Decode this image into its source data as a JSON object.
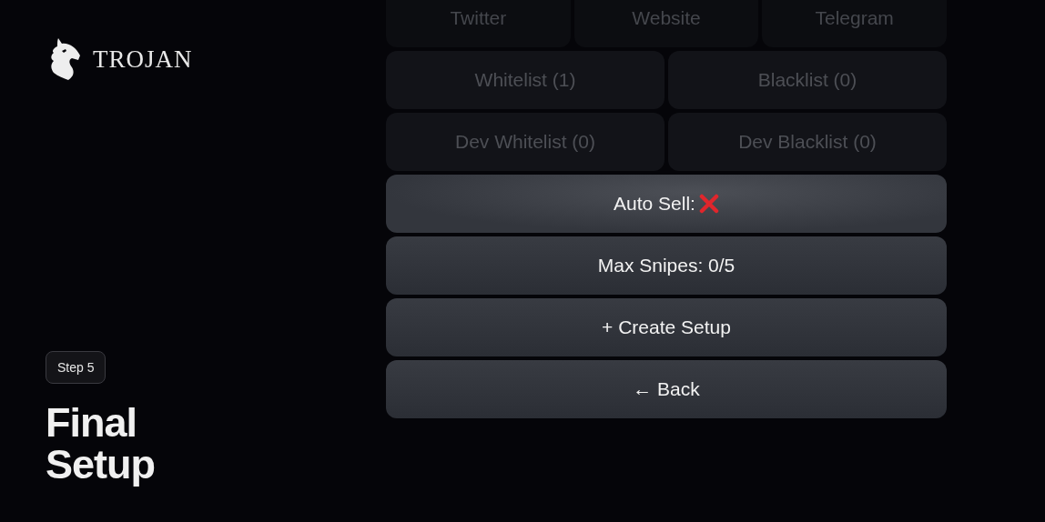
{
  "brand": {
    "name": "TROJAN"
  },
  "step": {
    "badge": "Step 5",
    "title": "Final Setup"
  },
  "button_rows": [
    {
      "kind": "ghost",
      "buttons": [
        {
          "label": "Twitter"
        },
        {
          "label": "Website"
        },
        {
          "label": "Telegram"
        }
      ]
    },
    {
      "kind": "faded",
      "buttons": [
        {
          "label": "Whitelist (1)"
        },
        {
          "label": "Blacklist (0)"
        }
      ]
    },
    {
      "kind": "faded",
      "buttons": [
        {
          "label": "Dev Whitelist (0)"
        },
        {
          "label": "Dev Blacklist (0)"
        }
      ]
    },
    {
      "kind": "highlighted",
      "buttons": [
        {
          "label": "Auto Sell:",
          "kind": "toggle",
          "on": false
        }
      ]
    },
    {
      "kind": "normal",
      "buttons": [
        {
          "label": "Max Snipes: 0/5"
        }
      ]
    },
    {
      "kind": "normal",
      "buttons": [
        {
          "label": "+ Create Setup"
        }
      ]
    },
    {
      "kind": "normal",
      "buttons": [
        {
          "label": "← Back"
        }
      ]
    }
  ]
}
